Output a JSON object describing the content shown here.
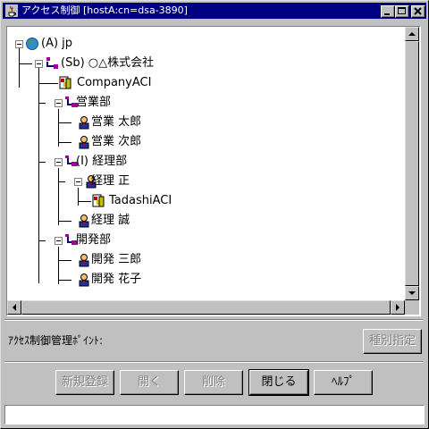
{
  "window": {
    "title": "アクセス制御 [hostA:cn=dsa-3890]",
    "controls": [
      "minimize-icon",
      "maximize-icon",
      "close-icon"
    ]
  },
  "tree": {
    "nodes": [
      {
        "label": "(A) jp",
        "icon": "globe-icon",
        "expanded": true
      },
      {
        "label": "(Sb) ○△株式会社",
        "icon": "organization-icon",
        "expanded": true
      },
      {
        "label": "CompanyACI",
        "icon": "aci-icon"
      },
      {
        "label": "営業部",
        "icon": "org-unit-icon",
        "expanded": true
      },
      {
        "label": "営業 太郎",
        "icon": "person-icon"
      },
      {
        "label": "営業 次郎",
        "icon": "person-icon"
      },
      {
        "label": "(I) 経理部",
        "icon": "org-unit-icon",
        "expanded": true
      },
      {
        "label": "経理 正",
        "icon": "person-icon",
        "expanded": true
      },
      {
        "label": "TadashiACI",
        "icon": "aci-icon"
      },
      {
        "label": "経理 誠",
        "icon": "person-icon"
      },
      {
        "label": "開発部",
        "icon": "org-unit-icon",
        "expanded": true
      },
      {
        "label": "開発 三郎",
        "icon": "person-icon"
      },
      {
        "label": "開発 花子",
        "icon": "person-icon"
      }
    ]
  },
  "access_control_point": {
    "label": "ｱｸｾｽ制御管理ﾎﾟｲﾝﾄ:",
    "type_button": "種別指定"
  },
  "buttons": {
    "register": "新規登録",
    "open": "開く",
    "delete": "削除",
    "close": "閉じる",
    "help": "ﾍﾙﾌﾟ"
  },
  "status": {
    "text": ""
  }
}
